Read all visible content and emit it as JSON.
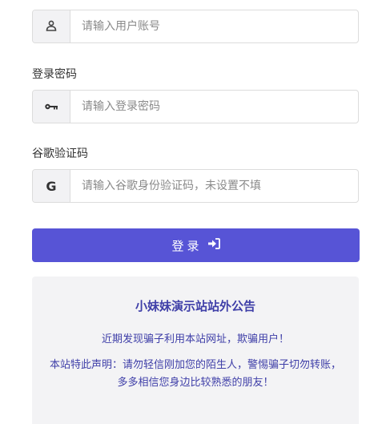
{
  "username": {
    "placeholder": "请输入用户账号",
    "icon": "user-icon"
  },
  "password": {
    "label": "登录密码",
    "placeholder": "请输入登录密码",
    "icon": "key-icon"
  },
  "google_code": {
    "label": "谷歌验证码",
    "placeholder": "请输入谷歌身份验证码，未设置不填",
    "icon_glyph": "G"
  },
  "login_button": {
    "label": "登录",
    "icon": "sign-in-icon"
  },
  "notice": {
    "title": "小妹妹演示站站外公告",
    "line1": "近期发现骗子利用本站网址，欺骗用户！",
    "line2": "本站特此声明：请勿轻信刚加您的陌生人，警惕骗子切勿转账，多多相信您身边比较熟悉的朋友！"
  },
  "colors": {
    "primary": "#5754d6",
    "notice_text": "#3f3fa8",
    "notice_bg": "#f3f3f5"
  }
}
